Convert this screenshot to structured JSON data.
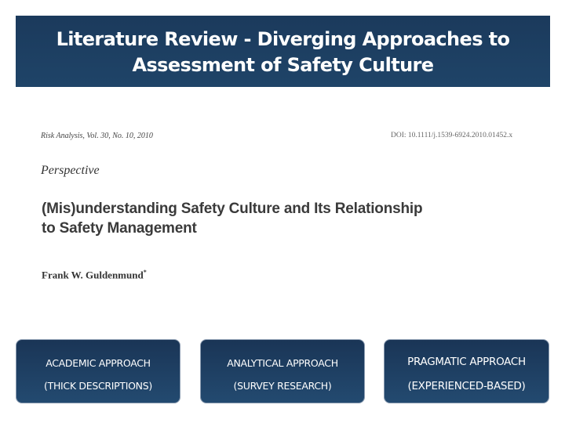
{
  "slide": {
    "title_line1": "Literature Review - Diverging Approaches to",
    "title_line2": "Assessment of Safety Culture"
  },
  "paper": {
    "journal": "Risk Analysis, Vol. 30, No. 10, 2010",
    "doi": "DOI: 10.1111/j.1539-6924.2010.01452.x",
    "section": "Perspective",
    "title_line1": "(Mis)understanding Safety Culture and Its Relationship",
    "title_line2": "to Safety Management",
    "author": "Frank W. Guldenmund",
    "author_mark": "*"
  },
  "approaches": [
    {
      "label": "ACADEMIC APPROACH",
      "sublabel": "(THICK DESCRIPTIONS)"
    },
    {
      "label": "ANALYTICAL APPROACH",
      "sublabel": "(SURVEY RESEARCH)"
    },
    {
      "label": "PRAGMATIC APPROACH",
      "sublabel": "(EXPERIENCED-BASED)"
    }
  ],
  "colors": {
    "title_bar": "#1f4468",
    "approach_box": "#1f3f63",
    "text_on_dark": "#ffffff"
  }
}
